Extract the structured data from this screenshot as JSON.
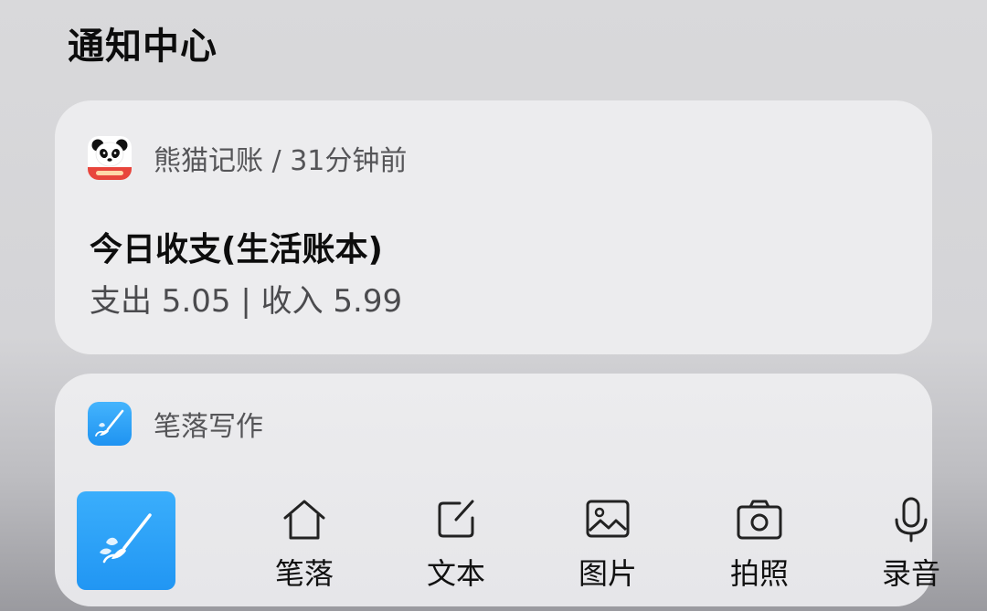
{
  "notification_center": {
    "title": "通知中心"
  },
  "notifications": [
    {
      "app_name": "熊猫记账",
      "separator": "/",
      "time": "31分钟前",
      "icon": "panda-icon",
      "title": "今日收支(生活账本)",
      "body": "支出 5.05 | 收入 5.99"
    },
    {
      "app_name": "笔落写作",
      "icon": "brush-icon",
      "actions": [
        {
          "label": "笔落",
          "icon": "home-icon"
        },
        {
          "label": "文本",
          "icon": "edit-icon"
        },
        {
          "label": "图片",
          "icon": "image-icon"
        },
        {
          "label": "拍照",
          "icon": "camera-icon"
        },
        {
          "label": "录音",
          "icon": "microphone-icon"
        }
      ]
    }
  ],
  "colors": {
    "background": "#d6d6d9",
    "card": "#ececee",
    "accent_blue": "#2196f3",
    "panda_red": "#e8453c"
  }
}
